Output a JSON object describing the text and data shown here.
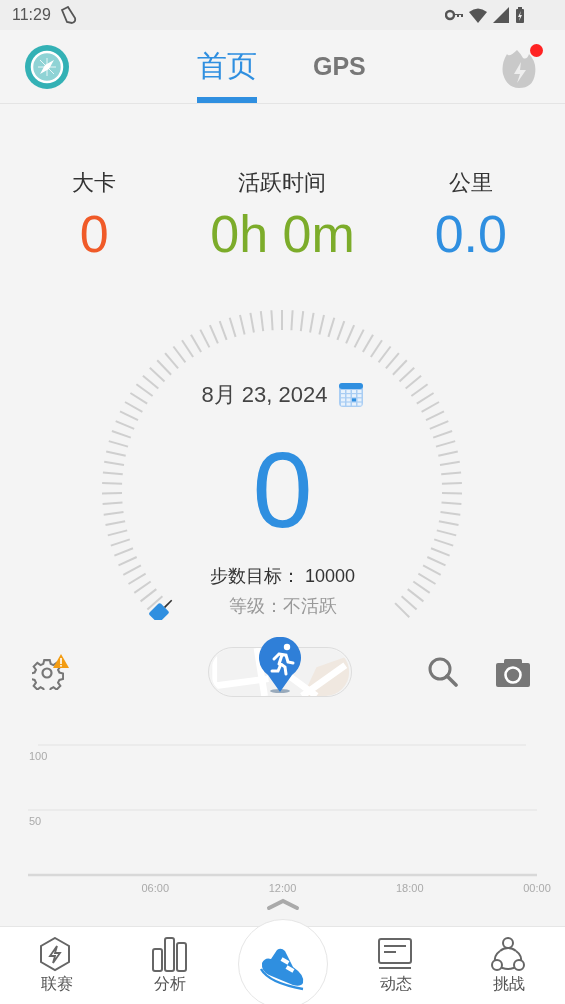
{
  "status_bar": {
    "time": "11:29"
  },
  "tabs": [
    {
      "label": "首页",
      "selected": true
    },
    {
      "label": "GPS",
      "selected": false
    }
  ],
  "notification": {
    "unread": true
  },
  "stats": [
    {
      "label": "大卡",
      "value": "0",
      "color": "#f05a28"
    },
    {
      "label": "活跃时间",
      "value": "0h 0m",
      "color": "#7cac2a"
    },
    {
      "label": "公里",
      "value": "0.0",
      "color": "#2f8fe0"
    }
  ],
  "gauge": {
    "date": "8月 23, 2024",
    "steps": "0",
    "goal": "步数目标： 10000",
    "rank": "等级：不活跃"
  },
  "actions": {
    "settings_warning": true
  },
  "chart": {
    "chart_data": {
      "type": "line",
      "ylim": [
        0,
        100
      ],
      "yticks": [
        50,
        100
      ],
      "xlim": [
        0,
        24
      ],
      "xticks": [
        {
          "value": 6,
          "label": "06:00"
        },
        {
          "value": 12,
          "label": "12:00"
        },
        {
          "value": 18,
          "label": "18:00"
        },
        {
          "value": 24,
          "label": "00:00"
        }
      ]
    }
  },
  "nav": [
    {
      "kind": "tab",
      "label": "联赛",
      "selected": false
    },
    {
      "kind": "tab",
      "label": "分析",
      "selected": false
    },
    {
      "kind": "center",
      "selected": true
    },
    {
      "kind": "tab",
      "label": "动态",
      "selected": false
    },
    {
      "kind": "tab",
      "label": "挑战",
      "selected": false
    }
  ]
}
